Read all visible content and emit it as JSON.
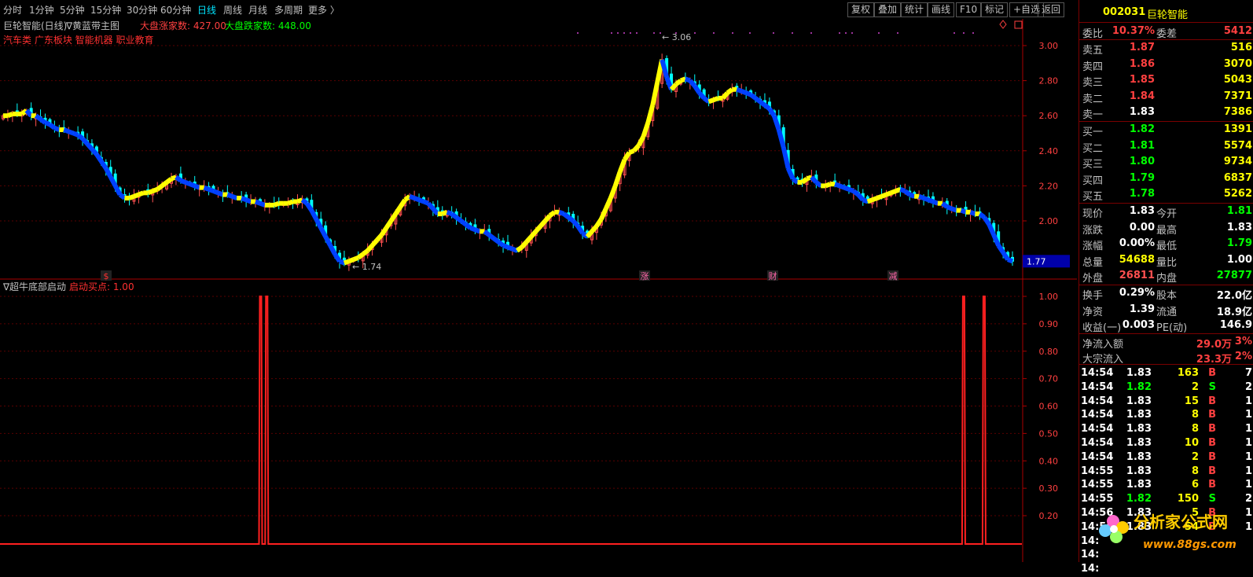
{
  "tabs": [
    "分时",
    "1分钟",
    "5分钟",
    "15分钟",
    "30分钟",
    "60分钟",
    "日线",
    "周线",
    "月线",
    "多周期",
    "更多 〉"
  ],
  "active_tab": "日线",
  "toolbar_right": [
    "复权",
    "叠加",
    "统计",
    "画线",
    "F10",
    "标记",
    "+自选",
    "返回"
  ],
  "main_header": {
    "name": "巨轮智能(日线)",
    "indicator": "∇黄蓝带主图",
    "up_label": "大盘涨家数: 427.00",
    "down_label": "大盘跌家数: 448.00"
  },
  "sector_tags": "汽车类 广东板块 智能机器 职业教育",
  "sub_header": {
    "name": "∇超牛底部启动",
    "param": "启动买点: 1.00"
  },
  "price_axis": [
    "3.00",
    "2.80",
    "2.60",
    "2.40",
    "2.20",
    "2.00"
  ],
  "current_price_tag": "1.77",
  "sub_axis": [
    "1.00",
    "0.90",
    "0.80",
    "0.70",
    "0.60",
    "0.50",
    "0.40",
    "0.30",
    "0.20"
  ],
  "annotations": {
    "high": "3.06",
    "low": "1.74"
  },
  "event_markers": [
    "$",
    "涨",
    "财",
    "减"
  ],
  "colors": {
    "up": "#ff5050",
    "down": "#00ffff",
    "yellow": "#ffff00",
    "blue": "#0040ff",
    "signal": "#ff2020",
    "grid": "#5a0000"
  },
  "chart_data": {
    "type": "candlestick",
    "title": "巨轮智能(日线)",
    "ylim": [
      1.7,
      3.1
    ],
    "close": [
      2.6,
      2.6,
      2.61,
      2.61,
      2.61,
      2.63,
      2.6,
      2.6,
      2.58,
      2.56,
      2.55,
      2.53,
      2.52,
      2.52,
      2.51,
      2.5,
      2.49,
      2.47,
      2.44,
      2.41,
      2.38,
      2.34,
      2.3,
      2.25,
      2.2,
      2.15,
      2.13,
      2.13,
      2.14,
      2.15,
      2.16,
      2.16,
      2.17,
      2.18,
      2.2,
      2.22,
      2.24,
      2.25,
      2.23,
      2.22,
      2.21,
      2.2,
      2.19,
      2.19,
      2.18,
      2.17,
      2.16,
      2.15,
      2.15,
      2.14,
      2.13,
      2.13,
      2.12,
      2.11,
      2.11,
      2.1,
      2.09,
      2.09,
      2.09,
      2.1,
      2.1,
      2.1,
      2.11,
      2.11,
      2.12,
      2.1,
      2.06,
      2.01,
      1.96,
      1.91,
      1.86,
      1.81,
      1.77,
      1.76,
      1.77,
      1.78,
      1.79,
      1.81,
      1.83,
      1.86,
      1.89,
      1.92,
      1.96,
      2.0,
      2.04,
      2.08,
      2.12,
      2.14,
      2.13,
      2.12,
      2.11,
      2.1,
      2.07,
      2.04,
      2.04,
      2.05,
      2.04,
      2.02,
      2.0,
      1.98,
      1.96,
      1.95,
      1.94,
      1.94,
      1.92,
      1.9,
      1.88,
      1.86,
      1.85,
      1.84,
      1.83,
      1.85,
      1.88,
      1.91,
      1.94,
      1.97,
      2.0,
      2.03,
      2.05,
      2.05,
      2.04,
      2.02,
      2.0,
      1.97,
      1.93,
      1.91,
      1.94,
      1.97,
      2.01,
      2.07,
      2.13,
      2.2,
      2.28,
      2.35,
      2.39,
      2.4,
      2.43,
      2.48,
      2.56,
      2.66,
      2.79,
      2.92,
      2.82,
      2.75,
      2.78,
      2.8,
      2.81,
      2.8,
      2.77,
      2.73,
      2.7,
      2.68,
      2.69,
      2.7,
      2.7,
      2.73,
      2.75,
      2.75,
      2.74,
      2.73,
      2.72,
      2.7,
      2.68,
      2.66,
      2.64,
      2.6,
      2.52,
      2.42,
      2.3,
      2.24,
      2.22,
      2.22,
      2.24,
      2.25,
      2.22,
      2.2,
      2.2,
      2.21,
      2.21,
      2.2,
      2.19,
      2.18,
      2.17,
      2.15,
      2.12,
      2.11,
      2.12,
      2.13,
      2.14,
      2.15,
      2.16,
      2.17,
      2.18,
      2.17,
      2.15,
      2.14,
      2.14,
      2.13,
      2.12,
      2.11,
      2.1,
      2.1,
      2.08,
      2.07,
      2.06,
      2.06,
      2.05,
      2.05,
      2.04,
      2.04,
      2.02,
      1.98,
      1.92,
      1.86,
      1.82,
      1.78,
      1.77
    ],
    "signals": [
      {
        "x": 0.255,
        "value": 1.0
      },
      {
        "x": 0.261,
        "value": 1.0
      },
      {
        "x": 0.943,
        "value": 1.0
      },
      {
        "x": 0.963,
        "value": 1.0
      }
    ]
  },
  "right_panel": {
    "code": "002031",
    "name": "巨轮智能",
    "weibi_label": "委比",
    "weibi": "10.37%",
    "weicha_label": "委差",
    "weicha": "5412",
    "asks": [
      {
        "label": "卖五",
        "price": "1.87",
        "vol": "516"
      },
      {
        "label": "卖四",
        "price": "1.86",
        "vol": "3070"
      },
      {
        "label": "卖三",
        "price": "1.85",
        "vol": "5043"
      },
      {
        "label": "卖二",
        "price": "1.84",
        "vol": "7371"
      },
      {
        "label": "卖一",
        "price": "1.83",
        "vol": "7386"
      }
    ],
    "bids": [
      {
        "label": "买一",
        "price": "1.82",
        "vol": "1391"
      },
      {
        "label": "买二",
        "price": "1.81",
        "vol": "5574"
      },
      {
        "label": "买三",
        "price": "1.80",
        "vol": "9734"
      },
      {
        "label": "买四",
        "price": "1.79",
        "vol": "6837"
      },
      {
        "label": "买五",
        "price": "1.78",
        "vol": "5262"
      }
    ],
    "stats": [
      {
        "l1": "现价",
        "v1": "1.83",
        "l2": "今开",
        "v2": "1.81",
        "c1": "#ffffff",
        "c2": "#00ff00"
      },
      {
        "l1": "涨跌",
        "v1": "0.00",
        "l2": "最高",
        "v2": "1.83",
        "c1": "#ffffff",
        "c2": "#ffffff"
      },
      {
        "l1": "涨幅",
        "v1": "0.00%",
        "l2": "最低",
        "v2": "1.79",
        "c1": "#ffffff",
        "c2": "#00ff00"
      },
      {
        "l1": "总量",
        "v1": "54688",
        "l2": "量比",
        "v2": "1.00",
        "c1": "#ffff00",
        "c2": "#ffffff"
      },
      {
        "l1": "外盘",
        "v1": "26811",
        "l2": "内盘",
        "v2": "27877",
        "c1": "#ff5050",
        "c2": "#00ff00"
      }
    ],
    "stats2": [
      {
        "l1": "换手",
        "v1": "0.29%",
        "l2": "股本",
        "v2": "22.0亿"
      },
      {
        "l1": "净资",
        "v1": "1.39",
        "l2": "流通",
        "v2": "18.9亿"
      },
      {
        "l1": "收益(一)",
        "v1": "0.003",
        "l2": "PE(动)",
        "v2": "146.9"
      }
    ],
    "flow": [
      {
        "l": "净流入额",
        "v": "29.0万",
        "p": "3%"
      },
      {
        "l": "大宗流入",
        "v": "23.3万",
        "p": "2%"
      }
    ],
    "ticks": [
      {
        "t": "14:54",
        "p": "1.83",
        "v": "163",
        "s": "B",
        "x": "7"
      },
      {
        "t": "14:54",
        "p": "1.82",
        "v": "2",
        "s": "S",
        "x": "2"
      },
      {
        "t": "14:54",
        "p": "1.83",
        "v": "15",
        "s": "B",
        "x": "1"
      },
      {
        "t": "14:54",
        "p": "1.83",
        "v": "8",
        "s": "B",
        "x": "1"
      },
      {
        "t": "14:54",
        "p": "1.83",
        "v": "8",
        "s": "B",
        "x": "1"
      },
      {
        "t": "14:54",
        "p": "1.83",
        "v": "10",
        "s": "B",
        "x": "1"
      },
      {
        "t": "14:54",
        "p": "1.83",
        "v": "2",
        "s": "B",
        "x": "1"
      },
      {
        "t": "14:55",
        "p": "1.83",
        "v": "8",
        "s": "B",
        "x": "1"
      },
      {
        "t": "14:55",
        "p": "1.83",
        "v": "6",
        "s": "B",
        "x": "1"
      },
      {
        "t": "14:55",
        "p": "1.82",
        "v": "150",
        "s": "S",
        "x": "2"
      },
      {
        "t": "14:56",
        "p": "1.83",
        "v": "5",
        "s": "B",
        "x": "1"
      },
      {
        "t": "14:56",
        "p": "1.83",
        "v": "54",
        "s": "B",
        "x": "1"
      },
      {
        "t": "14:",
        "p": "",
        "v": "",
        "s": "",
        "x": ""
      },
      {
        "t": "14:",
        "p": "",
        "v": "",
        "s": "",
        "x": ""
      },
      {
        "t": "14:",
        "p": "",
        "v": "",
        "s": "",
        "x": ""
      }
    ]
  },
  "logo": {
    "text": "分析家公式网",
    "url": "www.88gs.com"
  }
}
